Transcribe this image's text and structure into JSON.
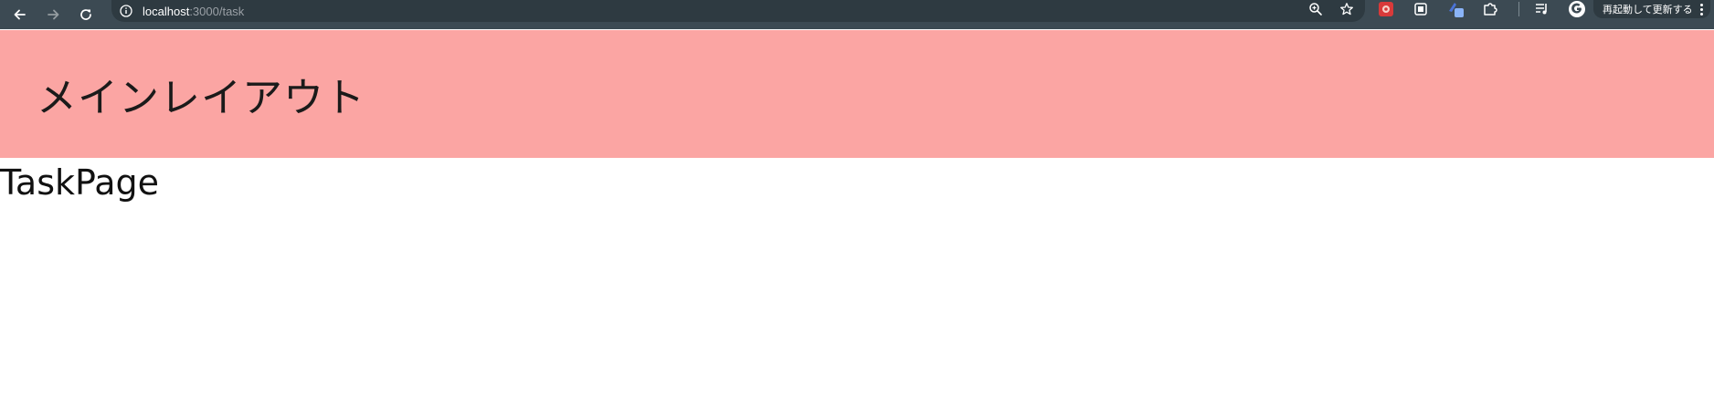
{
  "browser": {
    "url_host": "localhost",
    "url_rest": ":3000/task",
    "restart_label": "再起動して更新する",
    "icons": {
      "back": "arrow-left-icon",
      "forward": "arrow-right-icon",
      "reload": "reload-icon",
      "site_info": "info-icon",
      "zoom": "zoom-icon",
      "bookmark": "star-icon",
      "extensions": [
        "ext-red-icon",
        "ext-box-icon",
        "ext-blue-icon",
        "puzzle-icon"
      ],
      "media": "media-queue-icon",
      "account": "google-account-icon",
      "menu": "kebab-menu-icon"
    },
    "colors": {
      "toolbar": "#3c4a53",
      "omnibox": "#2e3a41"
    }
  },
  "page": {
    "header_title": "メインレイアウト",
    "header_color": "#fba5a3",
    "content_title": "TaskPage"
  }
}
